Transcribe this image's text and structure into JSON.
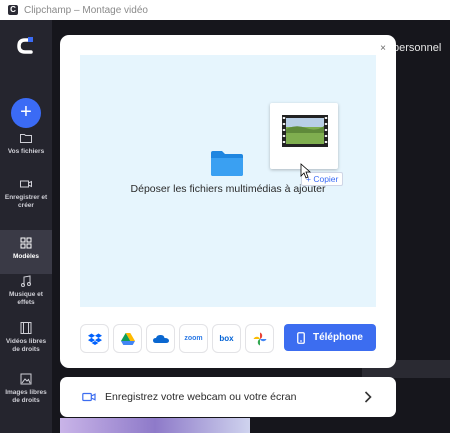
{
  "window": {
    "title": "Clipchamp – Montage vidéo"
  },
  "sidebar": {
    "create_label": "+",
    "items": [
      {
        "label": "Vos fichiers",
        "icon": "folder-icon"
      },
      {
        "label": "Enregistrer et créer",
        "icon": "camera-icon"
      },
      {
        "label": "Modèles",
        "icon": "templates-icon"
      },
      {
        "label": "Musique et effets",
        "icon": "music-icon"
      },
      {
        "label": "Vidéos libres de droits",
        "icon": "film-icon"
      },
      {
        "label": "Images libres de droits",
        "icon": "image-icon"
      }
    ]
  },
  "background": {
    "header_text": "personnel"
  },
  "modal": {
    "close_label": "×",
    "dropzone_text": "Déposer les fichiers multimédias à ajouter",
    "copy_badge": "+ Copier",
    "services": [
      "dropbox",
      "google-drive",
      "onedrive",
      "zoom",
      "box",
      "google-photos"
    ],
    "zoom_label": "zoom",
    "box_label": "box",
    "phone_button": "Téléphone"
  },
  "record_bar": {
    "text": "Enregistrez votre webcam ou votre écran"
  },
  "colors": {
    "accent": "#3c6df0",
    "sidebar": "#25252e",
    "dropzone": "#e6f5fd"
  }
}
